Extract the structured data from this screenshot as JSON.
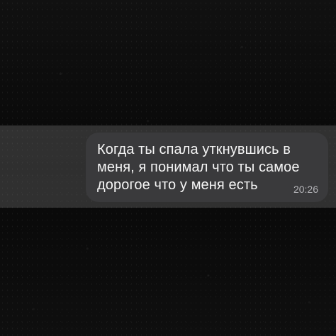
{
  "screen": {
    "background_color": "#0a0a0a",
    "strip_color": "rgba(255,255,255,0.16)",
    "bubble_color": "#3a3a3c",
    "text_color": "#f5f5f5",
    "time_color": "#b4b4b8"
  },
  "message": {
    "text": "Когда ты спала уткнувшись в меня, я понимал что ты самое дорогое что у меня есть",
    "time": "20:26"
  }
}
